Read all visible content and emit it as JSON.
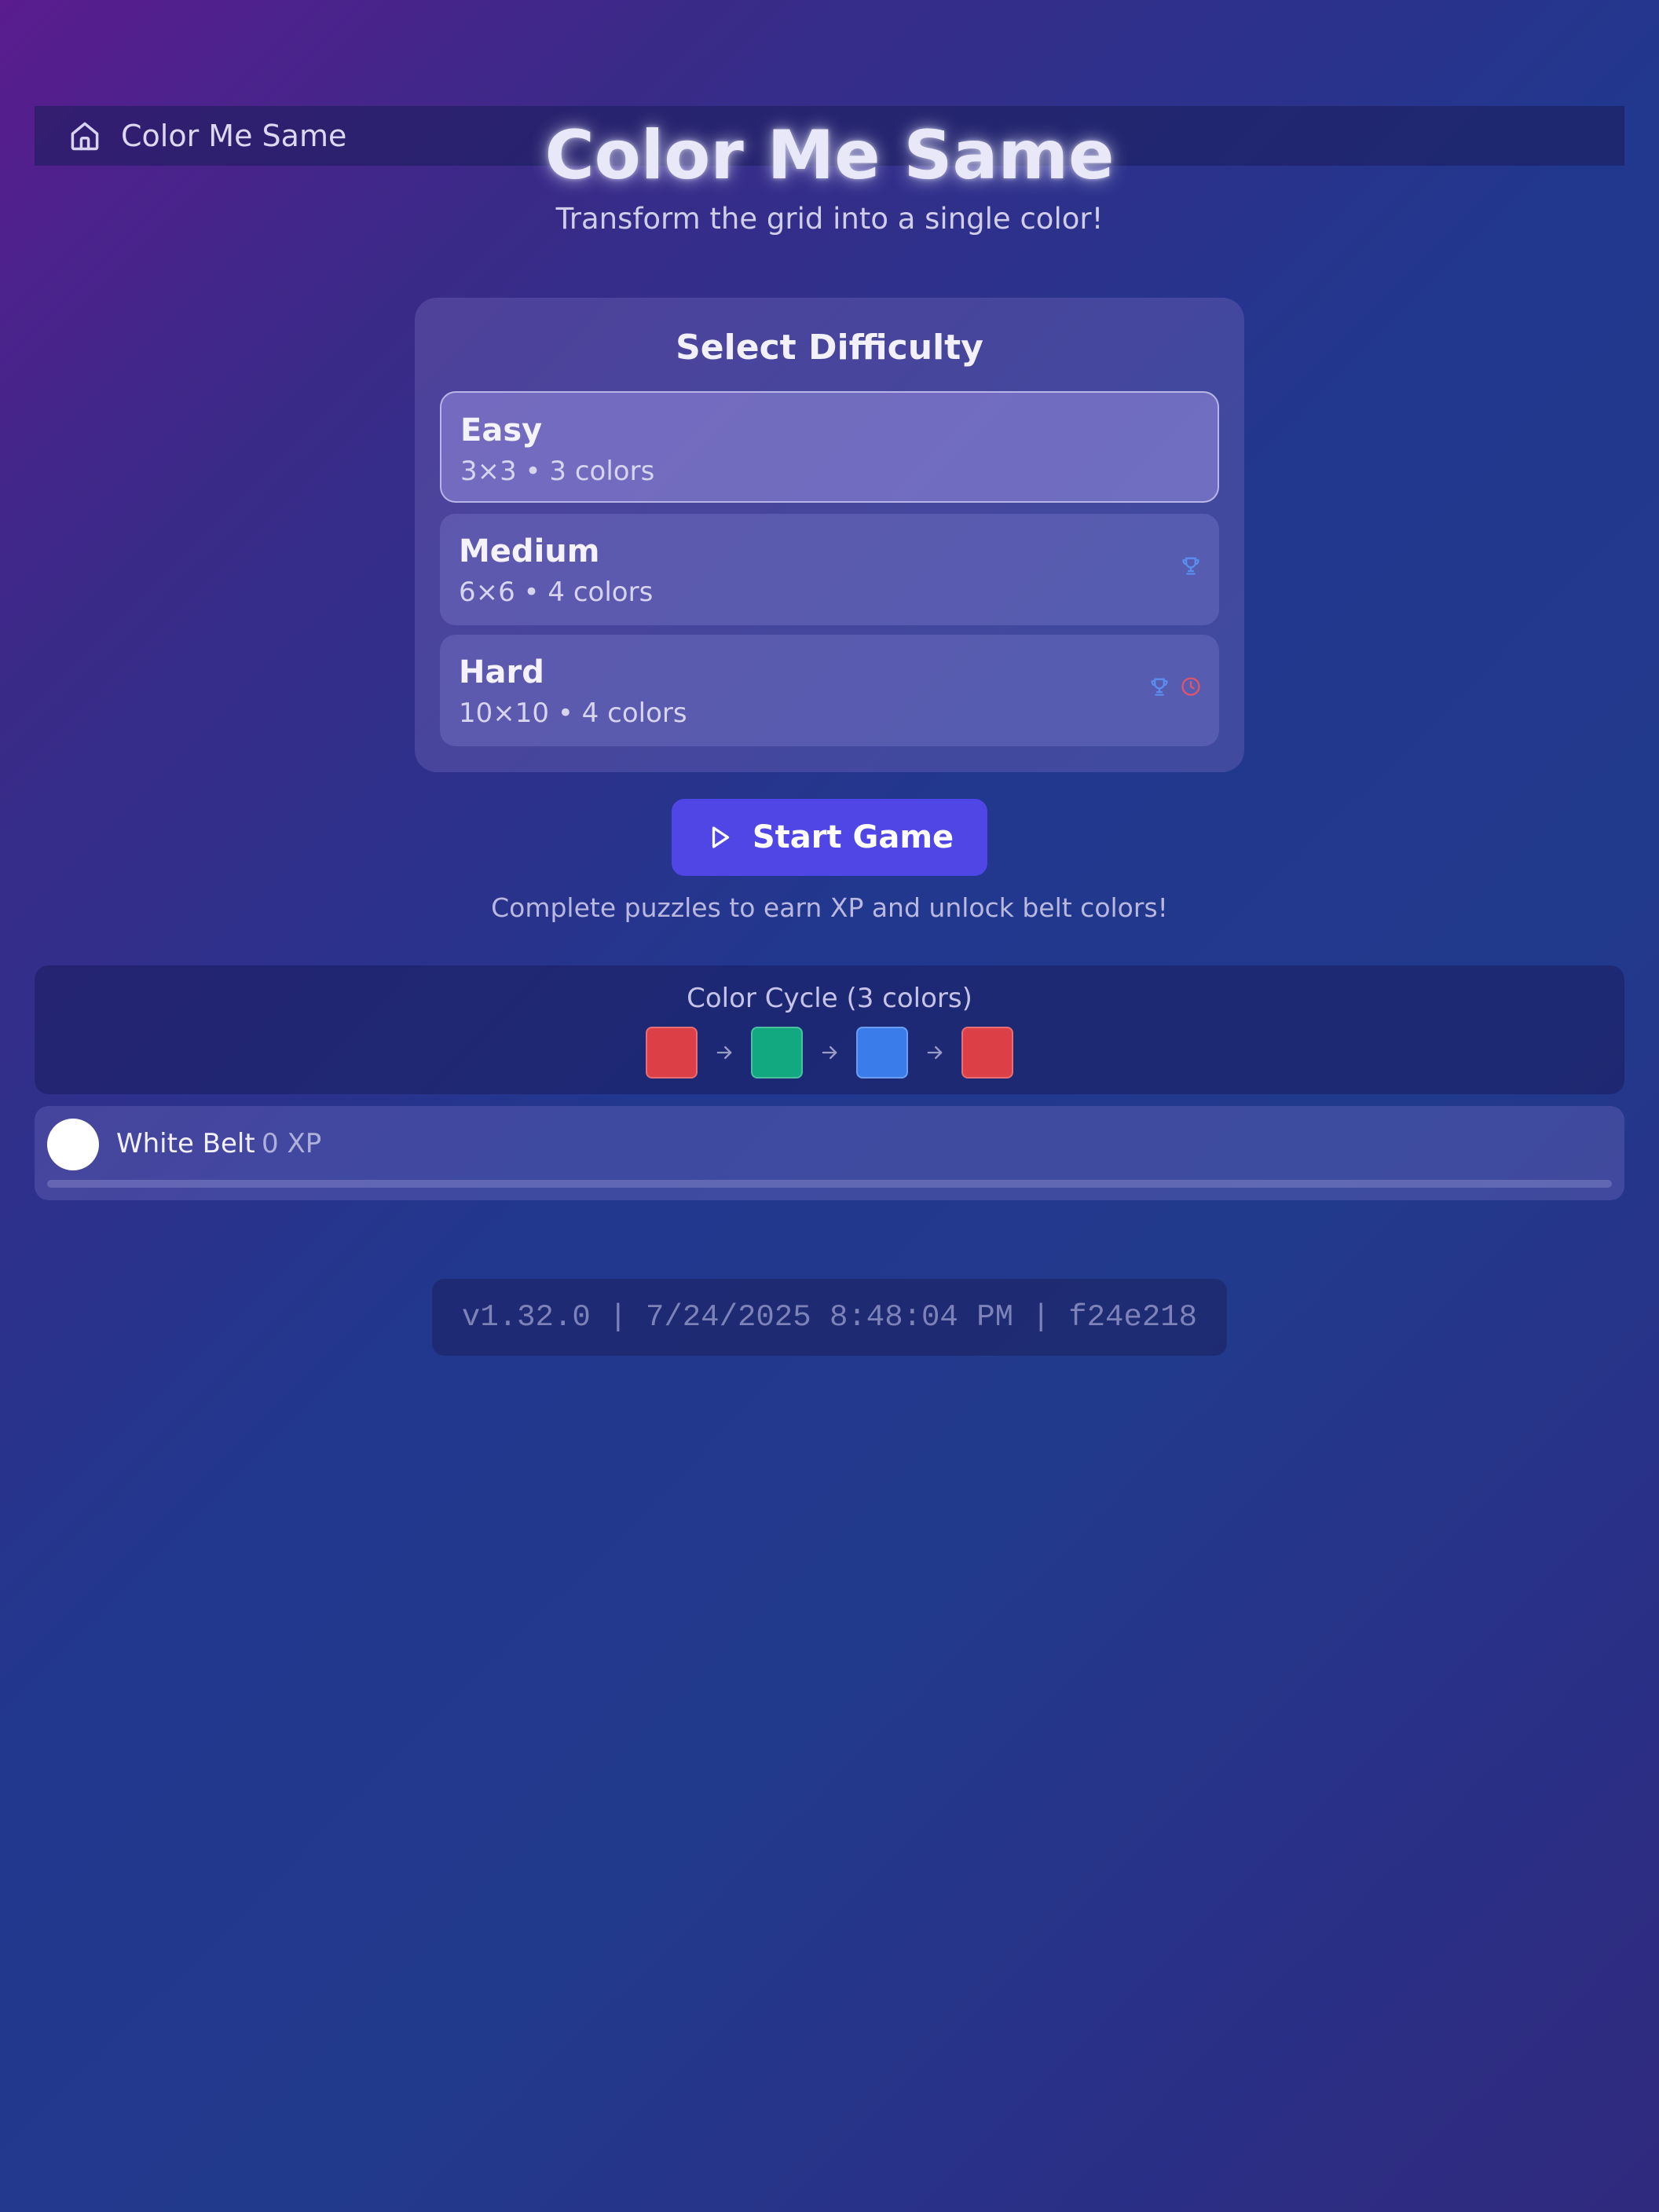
{
  "topbar": {
    "app_name": "Color Me Same",
    "icon": "home-icon"
  },
  "hero": {
    "title": "Color Me Same",
    "subtitle": "Transform the grid into a single color!"
  },
  "difficulty": {
    "title": "Select Difficulty",
    "options": [
      {
        "name": "Easy",
        "desc": "3×3 • 3 colors",
        "selected": true,
        "icons": []
      },
      {
        "name": "Medium",
        "desc": "6×6 • 4 colors",
        "selected": false,
        "icons": [
          "trophy-icon"
        ]
      },
      {
        "name": "Hard",
        "desc": "10×10 • 4 colors",
        "selected": false,
        "icons": [
          "trophy-icon",
          "clock-icon"
        ]
      }
    ]
  },
  "start_button": {
    "label": "Start Game",
    "icon": "play-icon"
  },
  "xp_note": "Complete puzzles to earn XP and unlock belt colors!",
  "color_cycle": {
    "title": "Color Cycle (3 colors)",
    "swatches": [
      "#dc3f46",
      "#12a980",
      "#3b7ceb",
      "#dc3f46"
    ]
  },
  "belt": {
    "name": "White Belt",
    "xp": "0 XP",
    "progress": 0
  },
  "version": "v1.32.0 | 7/24/2025 8:48:04 PM | f24e218",
  "colors": {
    "accent": "#4f46e5",
    "trophy": "#5b8def",
    "clock": "#e0556b"
  }
}
